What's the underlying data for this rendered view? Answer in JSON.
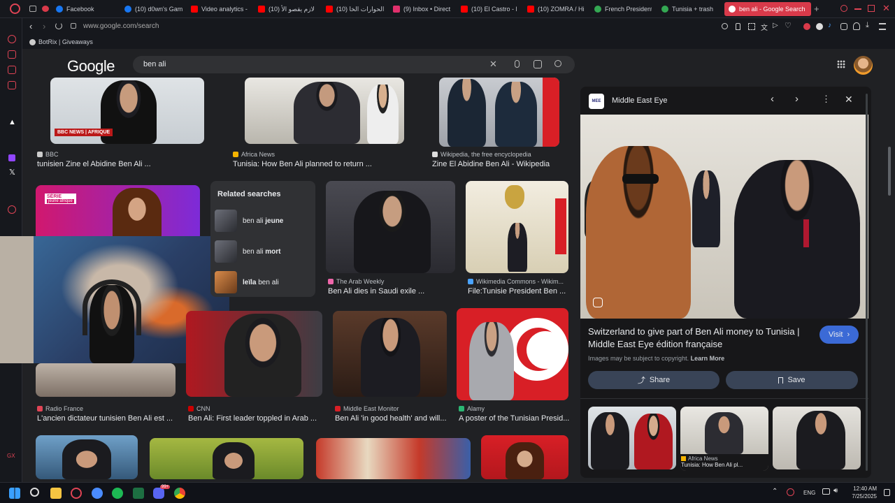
{
  "browser": {
    "tabs": [
      {
        "label": "Facebook",
        "color": "#1877f2"
      },
      {
        "label": "(10) d0wn's Gam",
        "color": "#1877f2"
      },
      {
        "label": "Video analytics -",
        "color": "#ff0000"
      },
      {
        "label": "لازم يقصو الأ (10)",
        "color": "#ff0000"
      },
      {
        "label": "الحوارات الخا (10)",
        "color": "#ff0000"
      },
      {
        "label": "(9) Inbox • Direct",
        "color": "#e1306c"
      },
      {
        "label": "(10) El Castro - E",
        "color": "#ff0000"
      },
      {
        "label": "(10) ZOMRA / Hi",
        "color": "#ff0000"
      },
      {
        "label": "French Presidenti",
        "color": "#34a853"
      },
      {
        "label": "Tunisia + trash",
        "color": "#34a853"
      },
      {
        "label": "ben ali - Google Search",
        "color": "#ffffff"
      }
    ],
    "url": "www.google.com/search",
    "bookmark": "BotRix | Giveaways"
  },
  "google": {
    "logo": "Google",
    "query": "ben ali"
  },
  "results": {
    "row1": [
      {
        "source": "BBC",
        "title": "tunisien Zine el Abidine Ben Ali ...",
        "badge": "BBC NEWS | AFRIQUE"
      },
      {
        "source": "Africa News",
        "title": "Tunisia: How Ben Ali planned to return ..."
      },
      {
        "source": "Wikipedia, the free encyclopedia",
        "title": "Zine El Abidine Ben Ali - Wikipedia"
      }
    ],
    "row2": [
      {
        "badge_line1": "SÉRIE",
        "badge_line2": "jeune afrique"
      },
      {
        "source": "The Arab Weekly",
        "title": "Ben Ali dies in Saudi exile ..."
      },
      {
        "source": "Wikimedia Commons - Wikim...",
        "title": "File:Tunisie President Ben ..."
      }
    ],
    "row3": [
      {
        "source": "Radio France",
        "title": "L'ancien dictateur tunisien Ben Ali est ..."
      },
      {
        "source": "CNN",
        "title": "Ben Ali: First leader toppled in Arab ..."
      },
      {
        "source": "Middle East Monitor",
        "title": "Ben Ali 'in good health' and will..."
      },
      {
        "source": "Alamy",
        "title": "A poster of the Tunisian Presid..."
      }
    ]
  },
  "related": {
    "heading": "Related searches",
    "items": [
      {
        "prefix": "ben ali ",
        "bold": "jeune"
      },
      {
        "prefix": "ben ali ",
        "bold": "mort"
      },
      {
        "bold": "leïla",
        "suffix": " ben ali"
      }
    ]
  },
  "panel": {
    "source": "Middle East Eye",
    "logo_text": "MEE",
    "title": "Switzerland to give part of Ben Ali money to Tunisia | Middle East Eye édition française",
    "visit": "Visit",
    "copyright": "Images may be subject to copyright.",
    "learn_more": "Learn More",
    "share": "Share",
    "save": "Save",
    "related_source": "Africa News",
    "related_title": "Tunisia: How Ben Ali pl..."
  },
  "taskbar": {
    "lang": "ENG",
    "time": "12:40 AM",
    "date": "7/25/2025",
    "badge": "99+"
  },
  "sidebar_gx": "GX"
}
